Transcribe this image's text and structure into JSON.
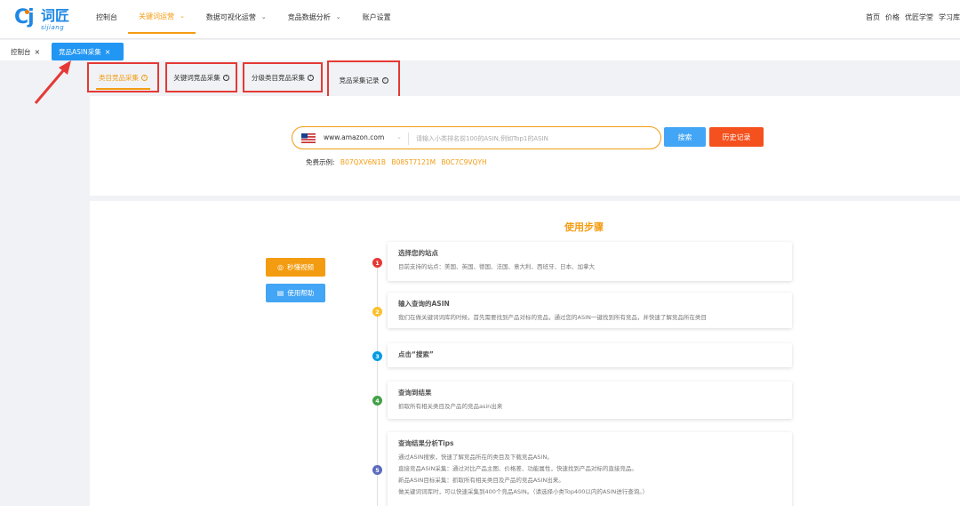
{
  "brand": {
    "logo_mark": "Cj",
    "name_cn": "词匠",
    "name_en": "sijiang"
  },
  "nav": {
    "items": [
      {
        "label": "控制台",
        "chevron": false
      },
      {
        "label": "关键词运营",
        "chevron": true
      },
      {
        "label": "数据可视化运营",
        "chevron": true
      },
      {
        "label": "竞品数据分析",
        "chevron": true
      },
      {
        "label": "账户设置",
        "chevron": false
      }
    ],
    "active_index": 1,
    "right_links": [
      "首页",
      "价格",
      "优匠学堂",
      "学习库"
    ]
  },
  "tabs": [
    {
      "label": "控制台",
      "close": "×"
    },
    {
      "label": "竞品ASIN采集",
      "close": "×"
    }
  ],
  "subtabs": [
    "类目竞品采集",
    "关键词竞品采集",
    "分级类目竞品采集",
    "竞品采集记录"
  ],
  "search": {
    "site": "www.amazon.com",
    "placeholder": "请输入小类排名前100的ASIN,例如Top1的ASIN",
    "value": "",
    "search_label": "搜索",
    "history_label": "历史记录",
    "examples_label": "免费示例:",
    "examples": [
      "B07QXV6N1B",
      "B085T7121M",
      "B0C7C9VQYH"
    ]
  },
  "steps": {
    "title": "使用步骤",
    "video_label": "秒懂视频",
    "help_label": "使用帮助",
    "items": [
      {
        "num": "1",
        "title": "选择您的站点",
        "desc": [
          "目前支持的站点：美国、英国、德国、法国、意大利、西班牙、日本、加拿大"
        ]
      },
      {
        "num": "2",
        "title": "输入查询的ASIN",
        "desc": [
          "我们在做关键词词库的时候，首先需要找到产品对标的竞品，通过您的ASIN一键找到所有竞品，并快速了解竞品所在类目"
        ]
      },
      {
        "num": "3",
        "title": "点击“搜索”",
        "desc": []
      },
      {
        "num": "4",
        "title": "查询到结果",
        "desc": [
          "抓取所有相关类目及产品的竞品asin出来"
        ]
      },
      {
        "num": "5",
        "title": "查询结果分析Tips",
        "desc": [
          "通过ASIN搜索，快速了解竞品所在的类目及下载竞品ASIN。",
          "直接竞品ASIN采集：通过对比产品主图、价格差、功能属性，快速找到产品对标的直接竞品。",
          "新品ASIN目标采集：抓取所有相关类目及产品的竞品ASIN出来。",
          "做关键词词库时，可以快速采集到400个竞品ASIN。（请选择小类Top400以内的ASIN进行查询。）"
        ]
      }
    ]
  },
  "colors": {
    "accent": "#f39c12",
    "primary": "#2196f3",
    "danger": "#e53935",
    "history": "#f4511e"
  },
  "icons": {
    "video": "play-circle-icon",
    "help": "document-icon",
    "help_q": "question-circle-icon",
    "flag": "us-flag-icon"
  }
}
